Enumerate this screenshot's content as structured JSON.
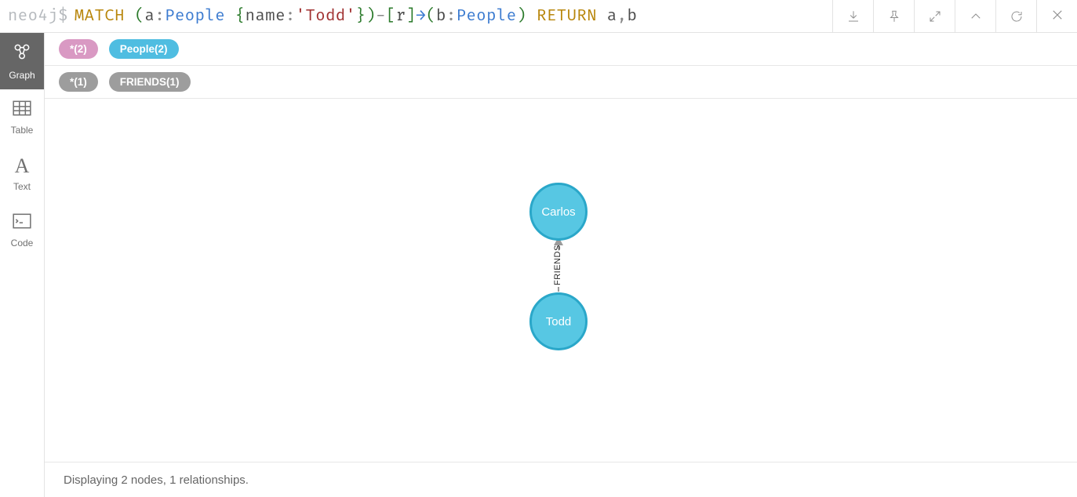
{
  "header": {
    "prompt": "neo4j$",
    "query": {
      "match": "MATCH",
      "open1": " (",
      "a": "a",
      "colon1": ":",
      "peopleA": "People",
      "nameObj": " {",
      "nameKey": "name",
      "colon2": ":",
      "nameVal": "'Todd'",
      "closeObj": "}",
      "close1": ")",
      "dash1": "-",
      "open2": "[",
      "r": "r",
      "close2": "]",
      "arrow": "→",
      "open3": "(",
      "b": "b",
      "colon3": ":",
      "peopleB": "People",
      "close3": ")",
      "return": " RETURN ",
      "ret_a": "a",
      "comma": ",",
      "ret_b": "b"
    }
  },
  "sidebar": {
    "tabs": [
      {
        "label": "Graph"
      },
      {
        "label": "Table"
      },
      {
        "label": "Text"
      },
      {
        "label": "Code"
      }
    ]
  },
  "labels": {
    "nodes": [
      {
        "text": "*(2)"
      },
      {
        "text": "People(2)"
      }
    ],
    "rels": [
      {
        "text": "*(1)"
      },
      {
        "text": "FRIENDS(1)"
      }
    ]
  },
  "graph": {
    "nodes": [
      {
        "name": "Carlos"
      },
      {
        "name": "Todd"
      }
    ],
    "relationship": {
      "type": "FRIENDS"
    }
  },
  "footer": {
    "status": "Displaying 2 nodes, 1 relationships."
  }
}
